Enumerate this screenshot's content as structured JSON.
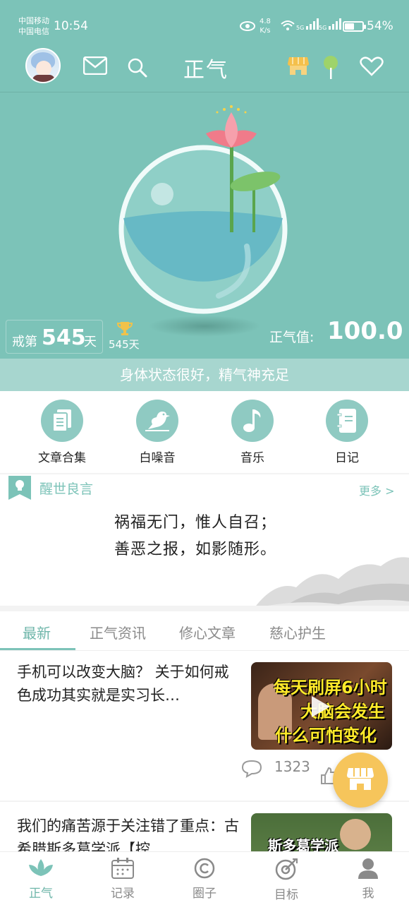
{
  "status_bar": {
    "carrier1": "中国移动",
    "carrier2": "中国电信",
    "time": "10:54",
    "speed_value": "4.8",
    "speed_unit": "K/s",
    "signal1": "5G",
    "signal2": "5G",
    "battery": "54%",
    "battery_level": 0.54
  },
  "header": {
    "title": "正气",
    "icons": [
      "mail-icon",
      "search-icon",
      "shop-icon",
      "tree-icon",
      "heart-icon"
    ]
  },
  "hero": {
    "days_prefix": "戒第",
    "days": "545",
    "days_suffix": "天",
    "trophy_days": "545天",
    "qi_label": "正气值:",
    "qi_value": "100.0",
    "status_text": "身体状态很好，精气神充足"
  },
  "quick_actions": [
    {
      "label": "文章合集",
      "icon": "documents-icon"
    },
    {
      "label": "白噪音",
      "icon": "bird-icon"
    },
    {
      "label": "音乐",
      "icon": "music-note-icon"
    },
    {
      "label": "日记",
      "icon": "notebook-icon"
    }
  ],
  "quote": {
    "title": "醒世良言",
    "more": "更多 >",
    "line1": "祸福无门，惟人自召；",
    "line2": "善恶之报，如影随形。"
  },
  "tabs": [
    "最新",
    "正气资讯",
    "修心文章",
    "慈心护生"
  ],
  "articles": [
    {
      "title": "手机可以改变大脑？ 关于如何戒色成功其实就是实习长…",
      "thumb_line1": "每天刷屏6小时",
      "thumb_line2": "大脑会发生",
      "thumb_line3": "什么可怕变化",
      "comments": "1323"
    },
    {
      "title": "我们的痛苦源于关注错了重点：古希腊斯多葛学派【控",
      "thumb_line1": "斯多葛学派"
    }
  ],
  "bottom_nav": [
    {
      "label": "正气",
      "icon": "lotus-icon"
    },
    {
      "label": "记录",
      "icon": "calendar-icon"
    },
    {
      "label": "圈子",
      "icon": "circle-icon"
    },
    {
      "label": "目标",
      "icon": "target-icon"
    },
    {
      "label": "我",
      "icon": "person-icon"
    }
  ],
  "colors": {
    "primary": "#7cc3b8",
    "accent": "#f6c55b"
  }
}
